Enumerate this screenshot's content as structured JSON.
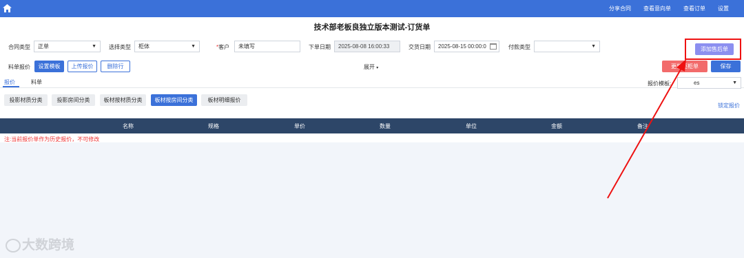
{
  "topnav": {
    "items": [
      "分享合同",
      "查看意向单",
      "查看订单",
      "设置"
    ]
  },
  "page_title": "技术部老板良独立版本测试-订货单",
  "form": {
    "contract_type_label": "合同类型",
    "contract_type_value": "正单",
    "select_type_label": "选择类型",
    "select_type_value": "柜体",
    "customer_label": "客户",
    "customer_required_mark": "*",
    "customer_value": "未填写",
    "order_date_label": "下单日期",
    "order_date_value": "2025-08-08 16:00:33",
    "delivery_date_label": "交货日期",
    "delivery_date_value": "2025-08-15 00:00:0",
    "payment_type_label": "付款类型",
    "payment_type_value": ""
  },
  "toolbar": {
    "material_quote_label": "料单报价",
    "set_template": "设置模板",
    "upload_quote": "上传报价",
    "delete_row": "删除行",
    "expand": "展开",
    "add_aftersale": "添加售后单",
    "update_cabinet": "更新柜柜单",
    "save": "保存"
  },
  "tabs": [
    "报价",
    "料单"
  ],
  "quote_template": {
    "label": "报价模板:",
    "value": "es"
  },
  "categories": [
    "投影材质分类",
    "投影房间分类",
    "板材按材质分类",
    "板材按房间分类",
    "板材明细报价"
  ],
  "lock_quote": "锁定报价",
  "table": {
    "columns": [
      "名称",
      "规格",
      "单价",
      "数量",
      "单位",
      "金额",
      "备注"
    ]
  },
  "note": "注:当前报价单作为历史报价，不可修改",
  "watermark": "大数跨境",
  "colors": {
    "primary": "#3b71d9",
    "header_dark": "#2d4668",
    "danger": "#f26b6b",
    "purple": "#8c8ff0",
    "annotation_red": "#e11111"
  }
}
